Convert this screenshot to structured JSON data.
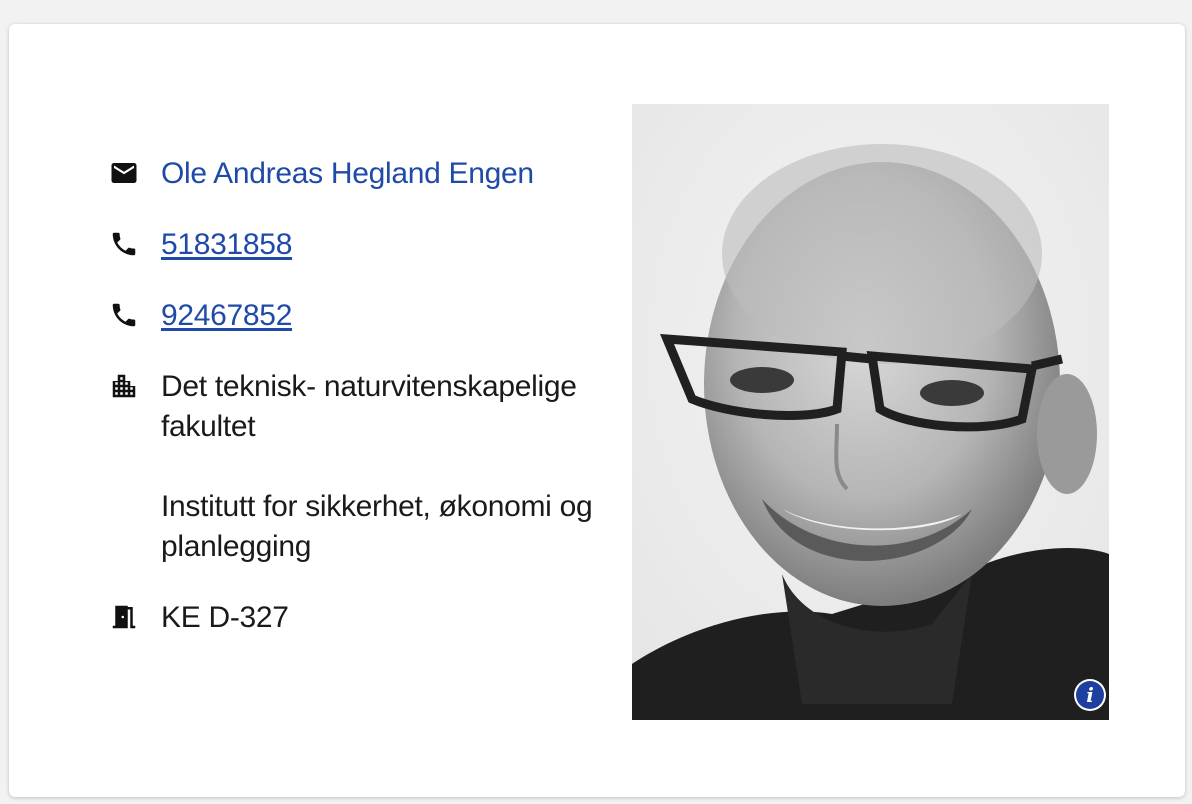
{
  "contact": {
    "name": "Ole Andreas Hegland Engen",
    "phone1": "51831858",
    "phone2": "92467852",
    "faculty": "Det teknisk- naturvitenskapelige fakultet",
    "department": "Institutt for sikkerhet, økonomi og planlegging",
    "office": "KE D-327"
  },
  "icons": {
    "email": "envelope-icon",
    "phone": "phone-icon",
    "organization": "building-icon",
    "office": "door-icon",
    "info": "info-icon"
  },
  "photo": {
    "info_glyph": "i"
  },
  "colors": {
    "link": "#1f4aa8",
    "info_button": "#1f3fa0"
  }
}
